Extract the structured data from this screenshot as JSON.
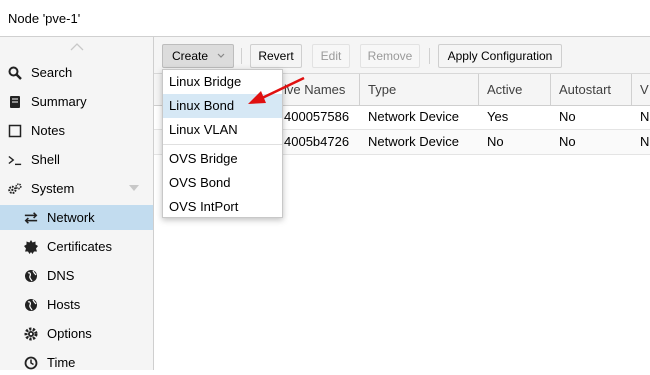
{
  "window": {
    "title": "Node 'pve-1'"
  },
  "sidebar": {
    "items": [
      {
        "label": "Search",
        "icon": "search-icon"
      },
      {
        "label": "Summary",
        "icon": "book-icon"
      },
      {
        "label": "Notes",
        "icon": "note-icon"
      },
      {
        "label": "Shell",
        "icon": "terminal-icon"
      },
      {
        "label": "System",
        "icon": "cogs-icon"
      },
      {
        "label": "Network",
        "icon": "network-exchange-icon"
      },
      {
        "label": "Certificates",
        "icon": "certificate-icon"
      },
      {
        "label": "DNS",
        "icon": "globe-icon"
      },
      {
        "label": "Hosts",
        "icon": "globe-icon"
      },
      {
        "label": "Options",
        "icon": "gear-icon"
      },
      {
        "label": "Time",
        "icon": "clock-icon"
      }
    ]
  },
  "toolbar": {
    "create_label": "Create",
    "revert_label": "Revert",
    "edit_label": "Edit",
    "remove_label": "Remove",
    "apply_label": "Apply Configuration"
  },
  "grid": {
    "columns": [
      "ive Names",
      "Type",
      "Active",
      "Autostart",
      "V"
    ],
    "rows": [
      {
        "names": "400057586",
        "type": "Network Device",
        "active": "Yes",
        "autostart": "No",
        "v": "N"
      },
      {
        "names": "4005b4726",
        "type": "Network Device",
        "active": "No",
        "autostart": "No",
        "v": "N"
      }
    ]
  },
  "create_menu": {
    "items": [
      "Linux Bridge",
      "Linux Bond",
      "Linux VLAN",
      "OVS Bridge",
      "OVS Bond",
      "OVS IntPort"
    ],
    "highlighted": "Linux Bond"
  },
  "colors": {
    "selected_bg": "#c2dcef",
    "menu_hover_bg": "#d6e8f5",
    "annotation_arrow": "#e01010"
  }
}
